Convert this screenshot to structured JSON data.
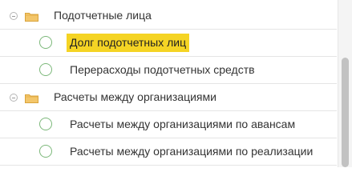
{
  "tree": {
    "groups": [
      {
        "label": "Подотчетные лица",
        "items": [
          {
            "label": "Долг подотчетных лиц",
            "selected": true
          },
          {
            "label": "Перерасходы подотчетных средств",
            "selected": false
          }
        ]
      },
      {
        "label": "Расчеты между организациями",
        "items": [
          {
            "label": "Расчеты между организациями по авансам",
            "selected": false
          },
          {
            "label": "Расчеты между организациями по реализации",
            "selected": false
          }
        ]
      }
    ]
  },
  "colors": {
    "selection": "#f5d424",
    "radio_ring": "#7cb87a",
    "folder_fill": "#f3c66a",
    "folder_stroke": "#d9a43c",
    "scroll_thumb": "#c2c2c2"
  },
  "icons": {
    "expander": "minus-circle-icon",
    "group": "folder-icon",
    "item": "radio-circle-icon"
  }
}
